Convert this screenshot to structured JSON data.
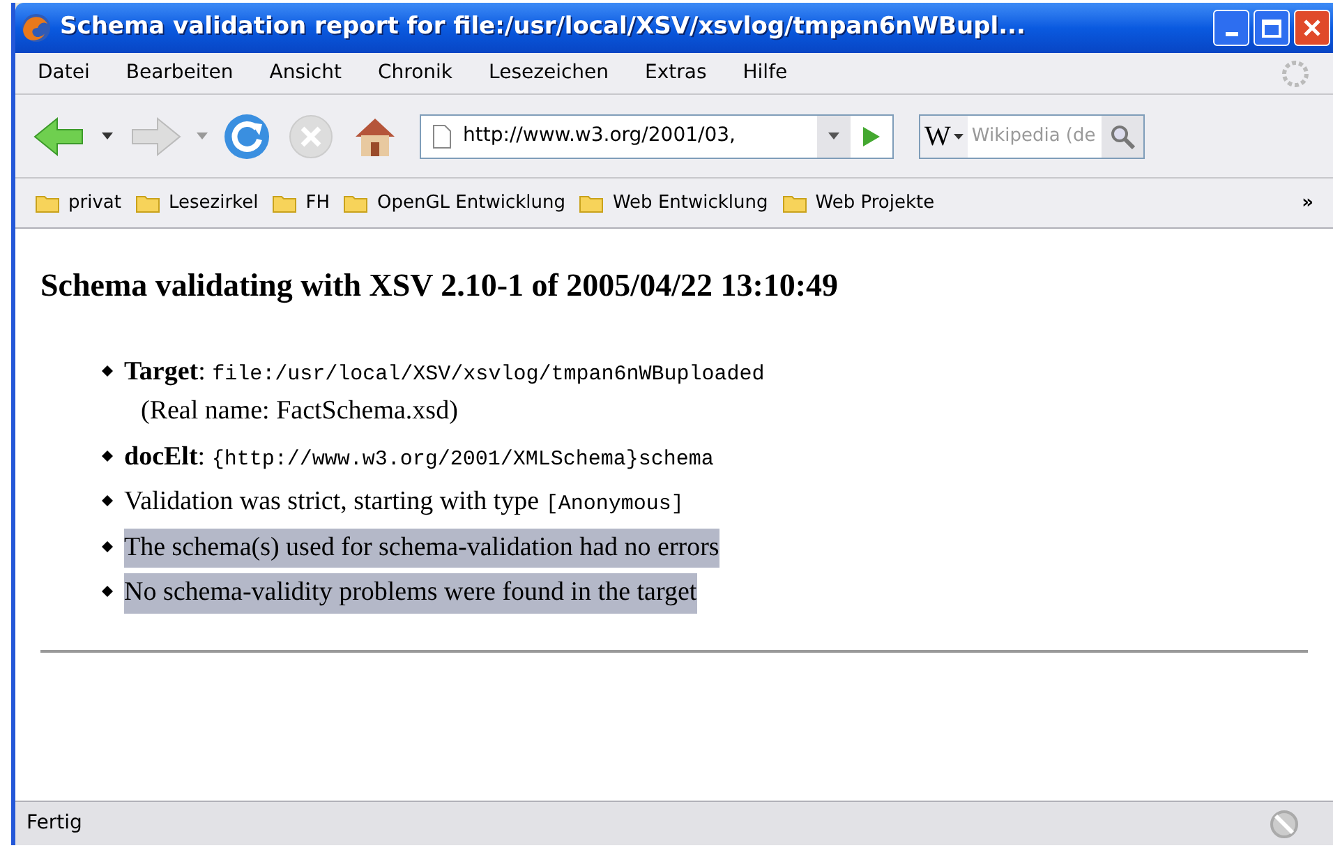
{
  "window": {
    "title": "Schema validation report for file:/usr/local/XSV/xsvlog/tmpan6nWBupl..."
  },
  "menu": [
    "Datei",
    "Bearbeiten",
    "Ansicht",
    "Chronik",
    "Lesezeichen",
    "Extras",
    "Hilfe"
  ],
  "address": {
    "value": "http://www.w3.org/2001/03,"
  },
  "search": {
    "engine": "W",
    "placeholder": "Wikipedia (de"
  },
  "bookmarks": [
    "privat",
    "Lesezirkel",
    "FH",
    "OpenGL Entwicklung",
    "Web Entwicklung",
    "Web Projekte"
  ],
  "bookmarks_more": "»",
  "heading": "Schema validating with XSV 2.10-1 of 2005/04/22 13:10:49",
  "items": [
    {
      "text": "**Target**: ",
      "code": "file:/usr/local/XSV/xsvlog/tmpan6nWBuploaded",
      "note": "(Real name: FactSchema.xsd)",
      "highlighted": false
    },
    {
      "text": "**docElt**: ",
      "code": "{http://www.w3.org/2001/XMLSchema}schema",
      "highlighted": false
    },
    {
      "text": "Validation was strict, starting with type ",
      "code": "[Anonymous]",
      "highlighted": false
    },
    {
      "text": "The schema(s) used for schema-validation had no errors",
      "highlighted": true
    },
    {
      "text": "No schema-validity problems were found in the target",
      "highlighted": true
    }
  ],
  "status_bar": "Fertig"
}
